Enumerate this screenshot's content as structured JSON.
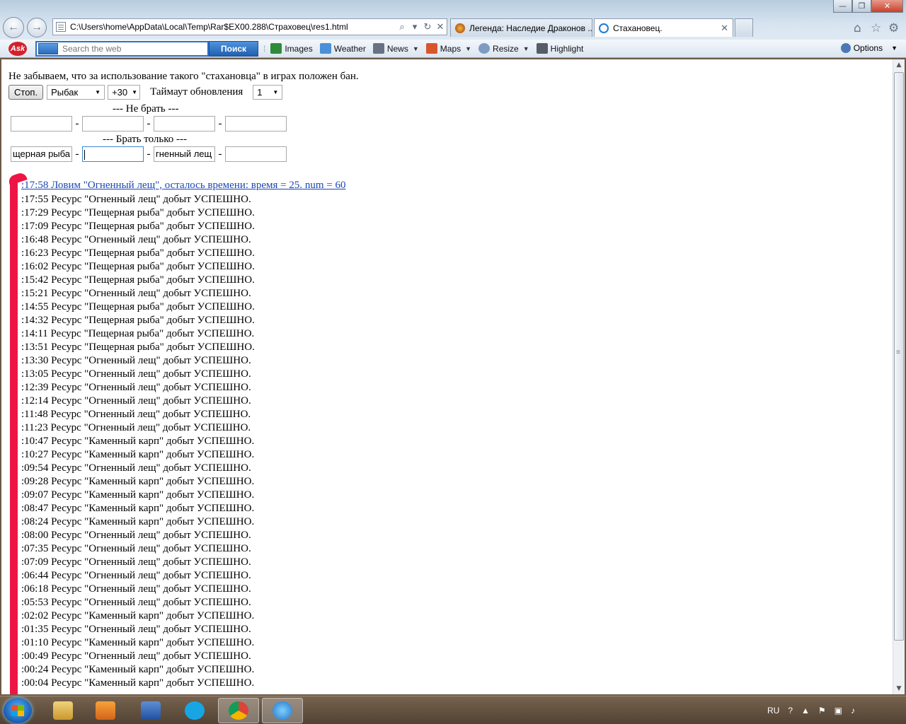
{
  "window": {
    "controls": {
      "minimize": "—",
      "maximize": "❐",
      "close": "✕"
    }
  },
  "browser": {
    "address": "C:\\Users\\home\\AppData\\Local\\Temp\\Rar$EX00.288\\Страховец\\res1.html",
    "tabs": [
      {
        "title": "Легенда: Наследие Драконов ..."
      },
      {
        "title": "Стахановец."
      }
    ]
  },
  "toolbar": {
    "search_placeholder": "Search the web",
    "search_button": "Поиск",
    "items": {
      "images": "Images",
      "weather": "Weather",
      "news": "News",
      "maps": "Maps",
      "resize": "Resize",
      "highlight": "Highlight"
    },
    "options": "Options"
  },
  "page": {
    "warning": "Не забываем, что за использование такого \"стахановца\" в играх положен бан.",
    "stop_button": "Стоп.",
    "profession_select": "Рыбак",
    "offset_select": "+30",
    "timeout_label": "Таймаут обновления",
    "timeout_select": "1",
    "no_take_title": "--- Не брать ---",
    "take_only_title": "--- Брать только ---",
    "take_only_values": [
      "щерная рыба",
      "",
      "гненный лещ",
      ""
    ],
    "dash": "-",
    "status_link": ":17:58 Ловим \"Огненный лещ\", осталось времени: время = 25. num = 60",
    "log": [
      ":17:55 Ресурс \"Огненный лещ\" добыт УСПЕШНО.",
      ":17:29 Ресурс \"Пещерная рыба\" добыт УСПЕШНО.",
      ":17:09 Ресурс \"Пещерная рыба\" добыт УСПЕШНО.",
      ":16:48 Ресурс \"Огненный лещ\" добыт УСПЕШНО.",
      ":16:23 Ресурс \"Пещерная рыба\" добыт УСПЕШНО.",
      ":16:02 Ресурс \"Пещерная рыба\" добыт УСПЕШНО.",
      ":15:42 Ресурс \"Пещерная рыба\" добыт УСПЕШНО.",
      ":15:21 Ресурс \"Огненный лещ\" добыт УСПЕШНО.",
      ":14:55 Ресурс \"Пещерная рыба\" добыт УСПЕШНО.",
      ":14:32 Ресурс \"Пещерная рыба\" добыт УСПЕШНО.",
      ":14:11 Ресурс \"Пещерная рыба\" добыт УСПЕШНО.",
      ":13:51 Ресурс \"Пещерная рыба\" добыт УСПЕШНО.",
      ":13:30 Ресурс \"Огненный лещ\" добыт УСПЕШНО.",
      ":13:05 Ресурс \"Огненный лещ\" добыт УСПЕШНО.",
      ":12:39 Ресурс \"Огненный лещ\" добыт УСПЕШНО.",
      ":12:14 Ресурс \"Огненный лещ\" добыт УСПЕШНО.",
      ":11:48 Ресурс \"Огненный лещ\" добыт УСПЕШНО.",
      ":11:23 Ресурс \"Огненный лещ\" добыт УСПЕШНО.",
      ":10:47 Ресурс \"Каменный карп\" добыт УСПЕШНО.",
      ":10:27 Ресурс \"Каменный карп\" добыт УСПЕШНО.",
      ":09:54 Ресурс \"Огненный лещ\" добыт УСПЕШНО.",
      ":09:28 Ресурс \"Каменный карп\" добыт УСПЕШНО.",
      ":09:07 Ресурс \"Каменный карп\" добыт УСПЕШНО.",
      ":08:47 Ресурс \"Каменный карп\" добыт УСПЕШНО.",
      ":08:24 Ресурс \"Каменный карп\" добыт УСПЕШНО.",
      ":08:00 Ресурс \"Огненный лещ\" добыт УСПЕШНО.",
      ":07:35 Ресурс \"Огненный лещ\" добыт УСПЕШНО.",
      ":07:09 Ресурс \"Огненный лещ\" добыт УСПЕШНО.",
      ":06:44 Ресурс \"Огненный лещ\" добыт УСПЕШНО.",
      ":06:18 Ресурс \"Огненный лещ\" добыт УСПЕШНО.",
      ":05:53 Ресурс \"Огненный лещ\" добыт УСПЕШНО.",
      ":02:02 Ресурс \"Каменный карп\" добыт УСПЕШНО.",
      ":01:35 Ресурс \"Огненный лещ\" добыт УСПЕШНО.",
      ":01:10 Ресурс \"Каменный карп\" добыт УСПЕШНО.",
      ":00:49 Ресурс \"Огненный лещ\" добыт УСПЕШНО.",
      ":00:24 Ресурс \"Каменный карп\" добыт УСПЕШНО.",
      ":00:04 Ресурс \"Каменный карп\" добыт УСПЕШНО."
    ],
    "marker_color": "#ee1545"
  },
  "taskbar": {
    "apps": [
      "windows-explorer",
      "media-player",
      "word",
      "skype",
      "chrome",
      "internet-explorer"
    ],
    "tray": {
      "language": "RU"
    }
  }
}
